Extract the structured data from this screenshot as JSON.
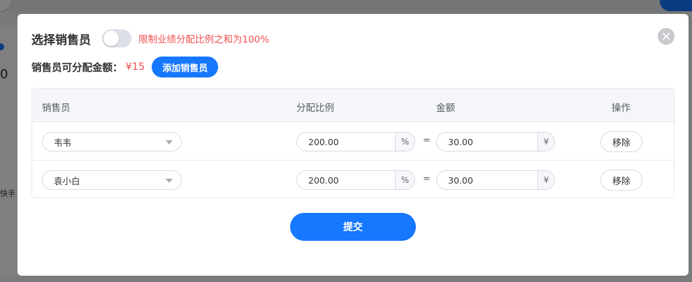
{
  "background": {
    "digit": "0",
    "sidebar_text": "快手"
  },
  "dialog": {
    "title": "选择销售员",
    "toggle_on": false,
    "hint": "限制业绩分配比例之和为100%",
    "amount_label": "销售员可分配金额：",
    "amount_value": "¥15",
    "add_button": "添加销售员",
    "submit_button": "提交",
    "table": {
      "headers": {
        "salesperson": "销售员",
        "ratio": "分配比例",
        "amount": "金额",
        "action": "操作"
      },
      "rows": [
        {
          "salesperson": "韦韦",
          "ratio": "200.00",
          "ratio_unit": "%",
          "equals": "=",
          "amount": "30.00",
          "amount_unit": "¥",
          "action": "移除"
        },
        {
          "salesperson": "袁小白",
          "ratio": "200.00",
          "ratio_unit": "%",
          "equals": "=",
          "amount": "30.00",
          "amount_unit": "¥",
          "action": "移除"
        }
      ]
    }
  },
  "colors": {
    "accent": "#1677ff",
    "warning_text": "#f05050",
    "overlay": "rgba(0,0,0,0.5)"
  },
  "icons": {
    "close": "close-icon",
    "dropdown": "chevron-down-icon"
  }
}
